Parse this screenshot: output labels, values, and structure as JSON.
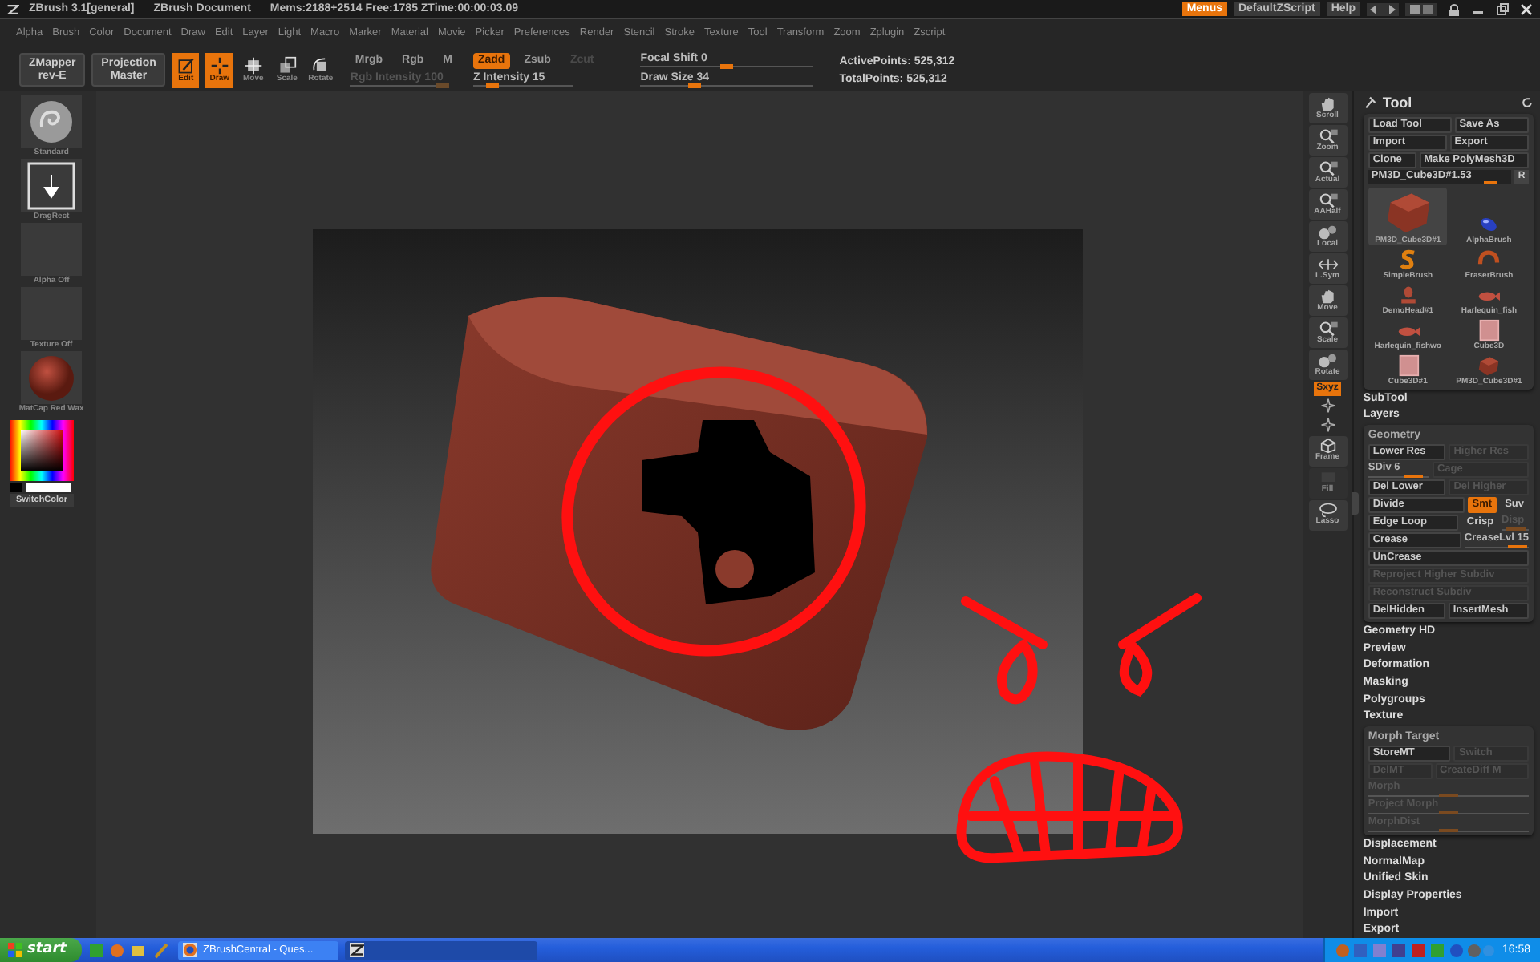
{
  "title_bar": {
    "app": "ZBrush 3.1[general]",
    "document": "ZBrush Document",
    "stats": "Mems:2188+2514 Free:1785 ZTime:00:00:03.09",
    "buttons": [
      {
        "label": "Menus",
        "selected": true
      },
      {
        "label": "DefaultZScript",
        "selected": false
      },
      {
        "label": "Help",
        "selected": false
      }
    ]
  },
  "menu_bar": [
    "Alpha",
    "Brush",
    "Color",
    "Document",
    "Draw",
    "Edit",
    "Layer",
    "Light",
    "Macro",
    "Marker",
    "Material",
    "Movie",
    "Picker",
    "Preferences",
    "Render",
    "Stencil",
    "Stroke",
    "Texture",
    "Tool",
    "Transform",
    "Zoom",
    "Zplugin",
    "Zscript"
  ],
  "toolbar": {
    "plugins": [
      {
        "label": "ZMapper",
        "sub": "rev-E"
      },
      {
        "label": "Projection",
        "sub": "Master"
      }
    ],
    "modes": [
      {
        "label": "Edit",
        "kind": "edit",
        "on": true
      },
      {
        "label": "Draw",
        "kind": "draw",
        "on": true
      },
      {
        "label": "Move",
        "kind": "move",
        "on": false
      },
      {
        "label": "Scale",
        "kind": "scale",
        "on": false
      },
      {
        "label": "Rotate",
        "kind": "rotate",
        "on": false
      }
    ],
    "color_modes": [
      {
        "label": "Mrgb",
        "on": false
      },
      {
        "label": "Rgb",
        "on": false
      },
      {
        "label": "M",
        "on": false
      }
    ],
    "rgb_intensity": {
      "label": "Rgb Intensity",
      "value": "100",
      "level": 1,
      "disabled": true
    },
    "z_modes": [
      {
        "label": "Zadd",
        "on": true,
        "disabled": false
      },
      {
        "label": "Zsub",
        "on": false,
        "disabled": false
      },
      {
        "label": "Zcut",
        "on": false,
        "disabled": true
      }
    ],
    "z_intensity": {
      "label": "Z Intensity",
      "value": "15",
      "level": 0.15,
      "disabled": false
    },
    "focal_shift": {
      "label": "Focal Shift",
      "value": "0",
      "level": 0.5,
      "disabled": false
    },
    "draw_size": {
      "label": "Draw Size",
      "value": "34",
      "level": 0.3,
      "disabled": false
    },
    "points": [
      {
        "label": "ActivePoints:",
        "value": "525,312"
      },
      {
        "label": "TotalPoints:",
        "value": "525,312"
      }
    ]
  },
  "left_shelf": [
    {
      "label": "Standard",
      "kind": "brush"
    },
    {
      "label": "DragRect",
      "kind": "stroke"
    },
    {
      "label": "Alpha Off",
      "kind": "empty"
    },
    {
      "label": "Texture Off",
      "kind": "empty"
    },
    {
      "label": "MatCap Red Wax",
      "kind": "material"
    }
  ],
  "color_picker": {
    "button": "SwitchColor"
  },
  "right_shelf": [
    {
      "label": "Scroll",
      "kind": "hand",
      "on": false,
      "disabled": false
    },
    {
      "label": "Zoom",
      "kind": "magnifier",
      "on": false,
      "disabled": false
    },
    {
      "label": "Actual",
      "kind": "magnifier",
      "on": false,
      "disabled": false
    },
    {
      "label": "AAHalf",
      "kind": "magnifier",
      "on": false,
      "disabled": false
    },
    {
      "label": "Local",
      "kind": "spheres",
      "on": false,
      "disabled": false
    },
    {
      "label": "L.Sym",
      "kind": "arrows",
      "on": false,
      "disabled": false
    },
    {
      "label": "Move",
      "kind": "hand",
      "on": false,
      "disabled": false
    },
    {
      "label": "Scale",
      "kind": "magnifier",
      "on": false,
      "disabled": false
    },
    {
      "label": "Rotate",
      "kind": "spheres",
      "on": false,
      "disabled": false
    },
    {
      "label": "Sxyz",
      "kind": "toggle",
      "on": true,
      "disabled": false
    },
    {
      "kind": "spark",
      "on": false,
      "disabled": false
    },
    {
      "kind": "spark",
      "on": false,
      "disabled": false
    },
    {
      "label": "Frame",
      "kind": "cube",
      "on": false,
      "disabled": false
    },
    {
      "label": "Fill",
      "kind": "screen",
      "on": false,
      "disabled": true
    },
    {
      "label": "Lasso",
      "kind": "lasso",
      "on": false,
      "disabled": false
    }
  ],
  "tool_palette": {
    "title": "Tool",
    "buttons": [
      [
        {
          "label": "Load Tool"
        },
        {
          "label": "Save As"
        }
      ],
      [
        {
          "label": "Import"
        },
        {
          "label": "Export"
        }
      ],
      [
        {
          "label": "Clone"
        },
        {
          "label": "Make PolyMesh3D"
        }
      ]
    ],
    "current_tool": {
      "label": "PM3D_Cube3D#1.53",
      "level": 0.9,
      "button": "R"
    },
    "tools": [
      {
        "label": "PM3D_Cube3D#1",
        "kind": "cube",
        "selected": true
      },
      {
        "label": "AlphaBrush",
        "kind": "alpha",
        "selected": false
      },
      {
        "label": "SimpleBrush",
        "kind": "simple",
        "selected": false
      },
      {
        "label": "EraserBrush",
        "kind": "eraser",
        "selected": false
      },
      {
        "label": "DemoHead#1",
        "kind": "head",
        "selected": false
      },
      {
        "label": "Harlequin_fish",
        "kind": "fish",
        "selected": false
      },
      {
        "label": "Harlequin_fishwo",
        "kind": "fish",
        "selected": false
      },
      {
        "label": "Cube3D",
        "kind": "tile",
        "selected": false
      },
      {
        "label": "Cube3D#1",
        "kind": "tile",
        "selected": false
      },
      {
        "label": "PM3D_Cube3D#1",
        "kind": "cube",
        "selected": false
      }
    ]
  },
  "sections": [
    {
      "label": "SubTool",
      "kind": "header"
    },
    {
      "label": "Layers",
      "kind": "header"
    },
    {
      "label": "Geometry",
      "kind": "panel",
      "rows": [
        [
          {
            "label": "Lower Res",
            "kind": "button",
            "disabled": false
          },
          {
            "label": "Higher Res",
            "kind": "button",
            "disabled": true
          }
        ],
        [
          {
            "label": "SDiv 6",
            "kind": "slider",
            "level": 0.85,
            "disabled": false
          },
          {
            "label": "Cage",
            "kind": "button",
            "disabled": true
          }
        ],
        [
          {
            "label": "Del Lower",
            "kind": "button",
            "disabled": false
          },
          {
            "label": "Del Higher",
            "kind": "button",
            "disabled": true
          }
        ],
        [
          {
            "label": "Divide",
            "kind": "button",
            "disabled": false
          },
          {
            "label": "Smt",
            "kind": "toggle",
            "on": true,
            "disabled": false
          },
          {
            "label": "Suv",
            "kind": "toggle",
            "on": false,
            "disabled": false
          }
        ],
        [
          {
            "label": "Edge Loop",
            "kind": "button",
            "disabled": false
          },
          {
            "label": "Crisp",
            "kind": "toggle",
            "on": false,
            "disabled": false
          },
          {
            "label": "Disp",
            "kind": "slider",
            "level": 0.5,
            "disabled": true
          }
        ],
        [
          {
            "label": "Crease",
            "kind": "button",
            "disabled": false
          },
          {
            "label": "CreaseLvl 15",
            "kind": "slider",
            "level": 0.95,
            "disabled": false
          }
        ],
        [
          {
            "label": "UnCrease",
            "kind": "button",
            "disabled": false
          }
        ],
        [
          {
            "label": "Reproject Higher Subdiv",
            "kind": "button",
            "disabled": true
          }
        ],
        [
          {
            "label": "Reconstruct Subdiv",
            "kind": "button",
            "disabled": true
          }
        ],
        [
          {
            "label": "DelHidden",
            "kind": "button",
            "disabled": false
          },
          {
            "label": "InsertMesh",
            "kind": "button",
            "disabled": false
          }
        ]
      ]
    },
    {
      "label": "Geometry HD",
      "kind": "header"
    },
    {
      "label": "Preview",
      "kind": "header"
    },
    {
      "label": "Deformation",
      "kind": "header"
    },
    {
      "label": "Masking",
      "kind": "header"
    },
    {
      "label": "Polygroups",
      "kind": "header"
    },
    {
      "label": "Texture",
      "kind": "header"
    },
    {
      "label": "Morph Target",
      "kind": "panel",
      "rows": [
        [
          {
            "label": "StoreMT",
            "kind": "button",
            "disabled": false
          },
          {
            "label": "Switch",
            "kind": "button",
            "disabled": true
          }
        ],
        [
          {
            "label": "DelMT",
            "kind": "button",
            "disabled": true
          },
          {
            "label": "CreateDiff M",
            "kind": "button",
            "disabled": true
          }
        ],
        [
          {
            "label": "Morph",
            "kind": "slider",
            "level": 0.5,
            "disabled": true
          }
        ],
        [
          {
            "label": "Project Morph",
            "kind": "slider",
            "level": 0.5,
            "disabled": true
          }
        ],
        [
          {
            "label": "MorphDist",
            "kind": "slider",
            "level": 0.5,
            "disabled": true
          }
        ]
      ]
    },
    {
      "label": "Displacement",
      "kind": "header"
    },
    {
      "label": "NormalMap",
      "kind": "header"
    },
    {
      "label": "Unified Skin",
      "kind": "header"
    },
    {
      "label": "Display Properties",
      "kind": "header"
    },
    {
      "label": "Import",
      "kind": "header"
    },
    {
      "label": "Export",
      "kind": "header"
    }
  ],
  "taskbar": {
    "start": "start",
    "tasks": [
      {
        "label": "ZBrushCentral - Ques...",
        "kind": "browser",
        "selected": false
      },
      {
        "kind": "zbrush",
        "selected": true
      }
    ],
    "clock": "16:58"
  }
}
